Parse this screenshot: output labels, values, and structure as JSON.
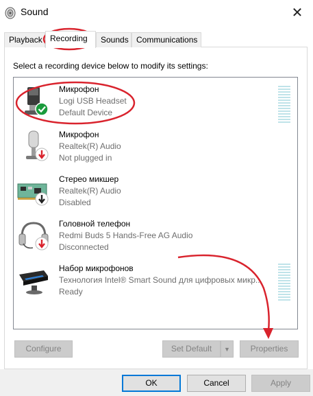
{
  "window": {
    "title": "Sound",
    "close_symbol": "✕"
  },
  "tabs": [
    {
      "label": "Playback",
      "active": false
    },
    {
      "label": "Recording",
      "active": true
    },
    {
      "label": "Sounds",
      "active": false
    },
    {
      "label": "Communications",
      "active": false
    }
  ],
  "instructions": "Select a recording device below to modify its settings:",
  "devices": [
    {
      "name": "Микрофон",
      "description": "Logi USB Headset",
      "state": "Default Device",
      "icon": "headset-microphone-icon",
      "badge": "default-check-icon"
    },
    {
      "name": "Микрофон",
      "description": "Realtek(R) Audio",
      "state": "Not plugged in",
      "icon": "microphone-icon",
      "badge": "unplugged-arrow-icon"
    },
    {
      "name": "Стерео микшер",
      "description": "Realtek(R) Audio",
      "state": "Disabled",
      "icon": "sound-card-icon",
      "badge": "disabled-arrow-icon"
    },
    {
      "name": "Головной телефон",
      "description": "Redmi Buds 5 Hands-Free AG Audio",
      "state": "Disconnected",
      "icon": "headset-icon",
      "badge": "disconnected-arrow-icon"
    },
    {
      "name": "Набор микрофонов",
      "description": "Технология Intel® Smart Sound для цифровых микр...",
      "state": "Ready",
      "icon": "microphone-array-icon",
      "badge": ""
    }
  ],
  "buttons": {
    "configure": "Configure",
    "set_default": "Set Default",
    "set_default_arrow": "▼",
    "properties": "Properties",
    "ok": "OK",
    "cancel": "Cancel",
    "apply": "Apply"
  },
  "colors": {
    "annotation_red": "#d9232d",
    "meter": "#bfe3e9",
    "check_green": "#1a9b3c",
    "unplugged_red": "#d9232d",
    "primary_border": "#0078d7"
  }
}
